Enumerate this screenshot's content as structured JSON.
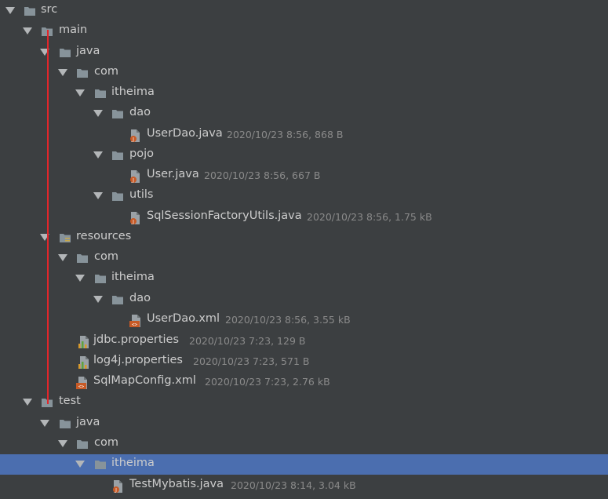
{
  "tree": {
    "src": {
      "label": "src",
      "icon": "folder-icon",
      "expanded": true
    },
    "main": {
      "label": "main",
      "icon": "folder-icon",
      "expanded": true
    },
    "main_java": {
      "label": "java",
      "icon": "folder-icon",
      "expanded": true
    },
    "main_java_com": {
      "label": "com",
      "icon": "folder-icon",
      "expanded": true
    },
    "main_java_itheima": {
      "label": "itheima",
      "icon": "folder-icon",
      "expanded": true
    },
    "dao": {
      "label": "dao",
      "icon": "folder-icon",
      "expanded": true
    },
    "userdao_java": {
      "label": "UserDao.java",
      "meta": "2020/10/23 8:56, 868 B",
      "icon": "java-file-icon"
    },
    "pojo": {
      "label": "pojo",
      "icon": "folder-icon",
      "expanded": true
    },
    "user_java": {
      "label": "User.java",
      "meta": "2020/10/23 8:56, 667 B",
      "icon": "java-file-icon"
    },
    "utils": {
      "label": "utils",
      "icon": "folder-icon",
      "expanded": true
    },
    "sqlsessionfactoryutils_java": {
      "label": "SqlSessionFactoryUtils.java",
      "meta": "2020/10/23 8:56, 1.75 kB",
      "icon": "java-file-icon"
    },
    "resources": {
      "label": "resources",
      "icon": "folder-icon",
      "expanded": true
    },
    "res_com": {
      "label": "com",
      "icon": "folder-icon",
      "expanded": true
    },
    "res_itheima": {
      "label": "itheima",
      "icon": "folder-icon",
      "expanded": true
    },
    "res_dao": {
      "label": "dao",
      "icon": "folder-icon",
      "expanded": true
    },
    "userdao_xml": {
      "label": "UserDao.xml",
      "meta": "2020/10/23 8:56, 3.55 kB",
      "icon": "xml-file-icon"
    },
    "jdbc_properties": {
      "label": "jdbc.properties",
      "meta": "2020/10/23 7:23, 129 B",
      "icon": "properties-file-icon"
    },
    "log4j_properties": {
      "label": "log4j.properties",
      "meta": "2020/10/23 7:23, 571 B",
      "icon": "properties-file-icon"
    },
    "sqlmapconfig_xml": {
      "label": "SqlMapConfig.xml",
      "meta": "2020/10/23 7:23, 2.76 kB",
      "icon": "xml-file-icon"
    },
    "test": {
      "label": "test",
      "icon": "folder-icon",
      "expanded": true
    },
    "test_java": {
      "label": "java",
      "icon": "folder-icon",
      "expanded": true
    },
    "test_com": {
      "label": "com",
      "icon": "folder-icon",
      "expanded": true
    },
    "test_itheima": {
      "label": "itheima",
      "icon": "folder-icon",
      "expanded": true,
      "selected": true
    },
    "testmybatis_java": {
      "label": "TestMybatis.java",
      "meta": "2020/10/23 8:14, 3.04 kB",
      "icon": "java-file-icon"
    }
  },
  "colors": {
    "background": "#3c3f41",
    "selection": "#4b6eaf",
    "folder": "#87939a",
    "annotation_line": "#e2262b"
  }
}
